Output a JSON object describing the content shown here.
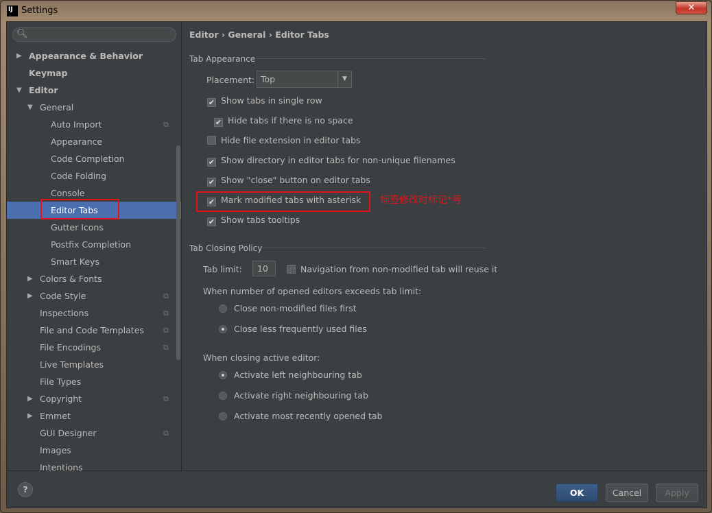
{
  "window": {
    "title": "Settings",
    "close": "✕"
  },
  "search": {
    "placeholder": ""
  },
  "tree": [
    {
      "label": "Appearance & Behavior",
      "level": 0,
      "arrow": "right",
      "bold": true
    },
    {
      "label": "Keymap",
      "level": 0,
      "arrow": "",
      "bold": true
    },
    {
      "label": "Editor",
      "level": 0,
      "arrow": "down",
      "bold": true
    },
    {
      "label": "General",
      "level": 1,
      "arrow": "down"
    },
    {
      "label": "Auto Import",
      "level": 2,
      "copy": true
    },
    {
      "label": "Appearance",
      "level": 2
    },
    {
      "label": "Code Completion",
      "level": 2
    },
    {
      "label": "Code Folding",
      "level": 2
    },
    {
      "label": "Console",
      "level": 2
    },
    {
      "label": "Editor Tabs",
      "level": 2,
      "selected": true
    },
    {
      "label": "Gutter Icons",
      "level": 2
    },
    {
      "label": "Postfix Completion",
      "level": 2
    },
    {
      "label": "Smart Keys",
      "level": 2
    },
    {
      "label": "Colors & Fonts",
      "level": 1,
      "arrow": "right"
    },
    {
      "label": "Code Style",
      "level": 1,
      "arrow": "right",
      "copy": true
    },
    {
      "label": "Inspections",
      "level": 1,
      "copy": true
    },
    {
      "label": "File and Code Templates",
      "level": 1,
      "copy": true
    },
    {
      "label": "File Encodings",
      "level": 1,
      "copy": true
    },
    {
      "label": "Live Templates",
      "level": 1
    },
    {
      "label": "File Types",
      "level": 1
    },
    {
      "label": "Copyright",
      "level": 1,
      "arrow": "right",
      "copy": true
    },
    {
      "label": "Emmet",
      "level": 1,
      "arrow": "right"
    },
    {
      "label": "GUI Designer",
      "level": 1,
      "copy": true
    },
    {
      "label": "Images",
      "level": 1
    },
    {
      "label": "Intentions",
      "level": 1
    }
  ],
  "breadcrumb": [
    "Editor",
    "General",
    "Editor Tabs"
  ],
  "breadcrumb_sep": "›",
  "tab_appearance": {
    "title": "Tab Appearance",
    "placement_label": "Placement:",
    "placement_value": "Top",
    "checks": [
      {
        "label": "Show tabs in single row",
        "checked": true
      },
      {
        "label": "Hide tabs if there is no space",
        "checked": true
      },
      {
        "label": "Hide file extension in editor tabs",
        "checked": false
      },
      {
        "label": "Show directory in editor tabs for non-unique filenames",
        "checked": true
      },
      {
        "label": "Show \"close\" button on editor tabs",
        "checked": true
      },
      {
        "label": "Mark modified tabs with asterisk",
        "checked": true
      },
      {
        "label": "Show tabs tooltips",
        "checked": true
      }
    ]
  },
  "annotation": "标签修改时标记*号",
  "tab_closing": {
    "title": "Tab Closing Policy",
    "tab_limit_label": "Tab limit:",
    "tab_limit_value": "10",
    "nav_reuse_label": "Navigation from non-modified tab will reuse it",
    "nav_reuse_checked": false,
    "exceeds_label": "When number of opened editors exceeds tab limit:",
    "exceeds_options": [
      {
        "label": "Close non-modified files first",
        "selected": false
      },
      {
        "label": "Close less frequently used files",
        "selected": true
      }
    ],
    "closing_label": "When closing active editor:",
    "closing_options": [
      {
        "label": "Activate left neighbouring tab",
        "selected": true
      },
      {
        "label": "Activate right neighbouring tab",
        "selected": false
      },
      {
        "label": "Activate most recently opened tab",
        "selected": false
      }
    ]
  },
  "footer": {
    "help": "?",
    "ok": "OK",
    "cancel": "Cancel",
    "apply": "Apply"
  }
}
